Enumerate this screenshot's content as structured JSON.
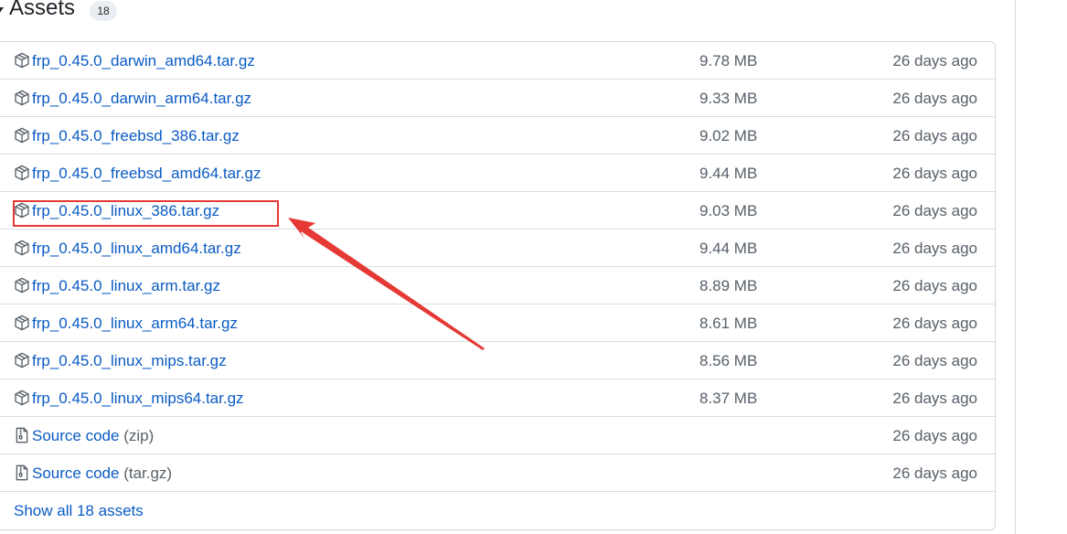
{
  "header": {
    "title": "Assets",
    "count": "18"
  },
  "assets": [
    {
      "name": "frp_0.45.0_darwin_amd64.tar.gz",
      "size": "9.78 MB",
      "date": "26 days ago",
      "icon": "package-icon"
    },
    {
      "name": "frp_0.45.0_darwin_arm64.tar.gz",
      "size": "9.33 MB",
      "date": "26 days ago",
      "icon": "package-icon"
    },
    {
      "name": "frp_0.45.0_freebsd_386.tar.gz",
      "size": "9.02 MB",
      "date": "26 days ago",
      "icon": "package-icon"
    },
    {
      "name": "frp_0.45.0_freebsd_amd64.tar.gz",
      "size": "9.44 MB",
      "date": "26 days ago",
      "icon": "package-icon"
    },
    {
      "name": "frp_0.45.0_linux_386.tar.gz",
      "size": "9.03 MB",
      "date": "26 days ago",
      "icon": "package-icon"
    },
    {
      "name": "frp_0.45.0_linux_amd64.tar.gz",
      "size": "9.44 MB",
      "date": "26 days ago",
      "icon": "package-icon"
    },
    {
      "name": "frp_0.45.0_linux_arm.tar.gz",
      "size": "8.89 MB",
      "date": "26 days ago",
      "icon": "package-icon"
    },
    {
      "name": "frp_0.45.0_linux_arm64.tar.gz",
      "size": "8.61 MB",
      "date": "26 days ago",
      "icon": "package-icon"
    },
    {
      "name": "frp_0.45.0_linux_mips.tar.gz",
      "size": "8.56 MB",
      "date": "26 days ago",
      "icon": "package-icon"
    },
    {
      "name": "frp_0.45.0_linux_mips64.tar.gz",
      "size": "8.37 MB",
      "date": "26 days ago",
      "icon": "package-icon"
    },
    {
      "name": "Source code",
      "suffix": "(zip)",
      "size": "",
      "date": "26 days ago",
      "icon": "file-zip-icon"
    },
    {
      "name": "Source code",
      "suffix": "(tar.gz)",
      "size": "",
      "date": "26 days ago",
      "icon": "file-zip-icon"
    }
  ],
  "footer": {
    "show_all": "Show all 18 assets"
  },
  "annotation": {
    "color": "#e53935",
    "highlighted_asset": "frp_0.45.0_linux_386.tar.gz"
  }
}
